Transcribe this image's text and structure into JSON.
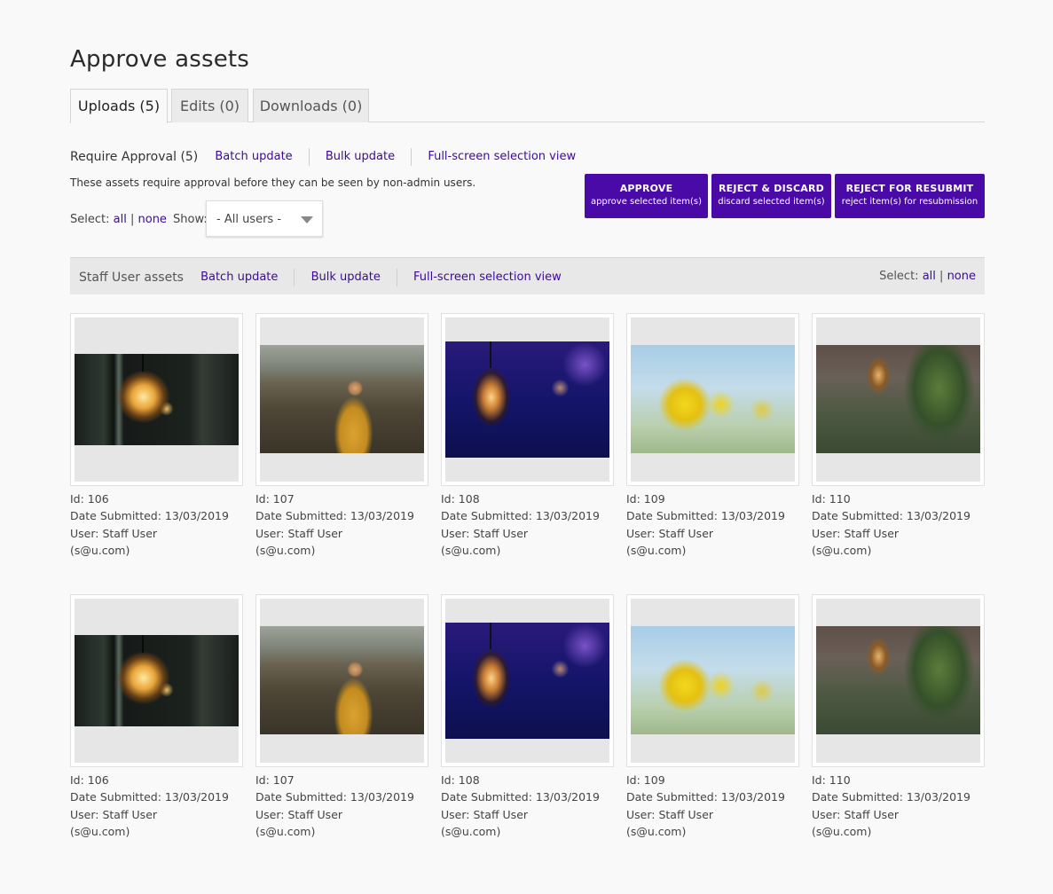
{
  "page_title": "Approve assets",
  "tabs": [
    {
      "label": "Uploads (5)",
      "active": true
    },
    {
      "label": "Edits (0)",
      "active": false
    },
    {
      "label": "Downloads (0)",
      "active": false
    }
  ],
  "require": {
    "title": "Require Approval (5)",
    "batch_update": "Batch update",
    "bulk_update": "Bulk update",
    "fullscreen": "Full-screen selection view",
    "description": "These assets require approval before they can be seen by non-admin users.",
    "select_label": "Select:",
    "all": "all",
    "pipe": "|",
    "none": "none",
    "show_label": "Show:",
    "show_value": "- All users -"
  },
  "actions": {
    "approve_title": "APPROVE",
    "approve_sub": "approve selected item(s)",
    "reject_title": "REJECT & DISCARD",
    "reject_sub": "discard selected item(s)",
    "resubmit_title": "REJECT FOR RESUBMIT",
    "resubmit_sub": "reject item(s) for resubmission"
  },
  "group": {
    "title": "Staff User assets",
    "batch_update": "Batch update",
    "bulk_update": "Bulk update",
    "fullscreen": "Full-screen selection view",
    "select_label": "Select:",
    "all": "all",
    "pipe": "|",
    "none": "none"
  },
  "assets": [
    {
      "id": "Id: 106",
      "date": "Date Submitted: 13/03/2019",
      "user": "User: Staff User",
      "email": "(s@u.com)"
    },
    {
      "id": "Id: 107",
      "date": "Date Submitted: 13/03/2019",
      "user": "User: Staff User",
      "email": "(s@u.com)"
    },
    {
      "id": "Id: 108",
      "date": "Date Submitted: 13/03/2019",
      "user": "User: Staff User",
      "email": "(s@u.com)"
    },
    {
      "id": "Id: 109",
      "date": "Date Submitted: 13/03/2019",
      "user": "User: Staff User",
      "email": "(s@u.com)"
    },
    {
      "id": "Id: 110",
      "date": "Date Submitted: 13/03/2019",
      "user": "User: Staff User",
      "email": "(s@u.com)"
    },
    {
      "id": "Id: 106",
      "date": "Date Submitted: 13/03/2019",
      "user": "User: Staff User",
      "email": "(s@u.com)"
    },
    {
      "id": "Id: 107",
      "date": "Date Submitted: 13/03/2019",
      "user": "User: Staff User",
      "email": "(s@u.com)"
    },
    {
      "id": "Id: 108",
      "date": "Date Submitted: 13/03/2019",
      "user": "User: Staff User",
      "email": "(s@u.com)"
    },
    {
      "id": "Id: 109",
      "date": "Date Submitted: 13/03/2019",
      "user": "User: Staff User",
      "email": "(s@u.com)"
    },
    {
      "id": "Id: 110",
      "date": "Date Submitted: 13/03/2019",
      "user": "User: Staff User",
      "email": "(s@u.com)"
    }
  ],
  "colors": {
    "accent": "#4a0aa8",
    "link": "#3c0a99",
    "background": "#f9f9f9"
  }
}
